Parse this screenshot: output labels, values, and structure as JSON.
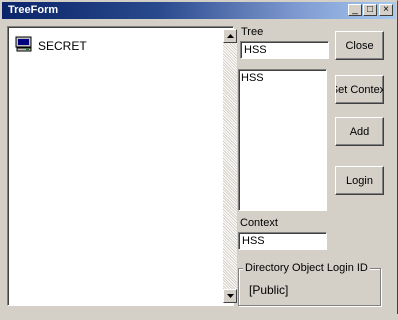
{
  "window": {
    "title": "TreeForm",
    "minimize_glyph": "_",
    "maximize_glyph": "□",
    "close_glyph": "×"
  },
  "tree": {
    "items": [
      {
        "label": "SECRET",
        "icon": "computer-icon"
      }
    ]
  },
  "tree_label": {
    "text": "Tree"
  },
  "tree_field": {
    "value": "HSS"
  },
  "list": {
    "items": [
      "HSS"
    ]
  },
  "context": {
    "label": "Context",
    "value": "HSS"
  },
  "buttons": {
    "close": "Close",
    "set_context": "Set Context",
    "add": "Add",
    "login": "Login"
  },
  "group": {
    "title": "Directory Object Login ID",
    "value": "[Public]"
  }
}
